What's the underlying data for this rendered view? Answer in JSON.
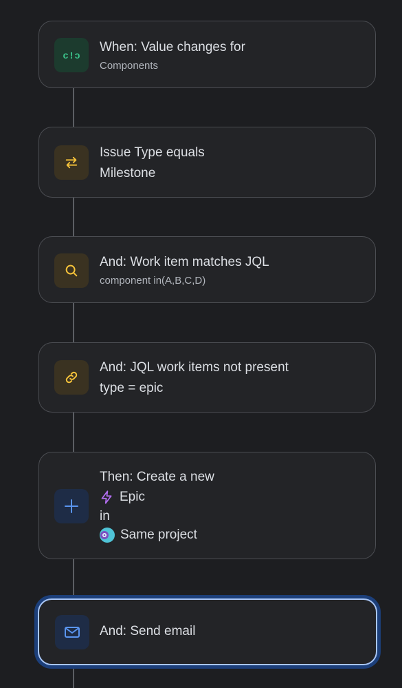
{
  "rule": {
    "trigger": {
      "title": "When: Value changes for",
      "subtitle": "Components",
      "icon": "trigger-icon",
      "tile_color": "#1c3b2e",
      "icon_color": "#3cc48c"
    },
    "condition_issue_type": {
      "title": "Issue Type equals",
      "subtitle": "Milestone",
      "icon": "swap-arrows-icon",
      "tile_color": "#3a3221",
      "icon_color": "#f5c23a"
    },
    "condition_jql": {
      "title": "And: Work item matches JQL",
      "subtitle": "component in(A,B,C,D)",
      "icon": "search-icon",
      "tile_color": "#3a3221",
      "icon_color": "#f5c23a"
    },
    "condition_related": {
      "title": "And: JQL work items not present",
      "subtitle": "type = epic",
      "icon": "link-icon",
      "tile_color": "#3a3221",
      "icon_color": "#f5c23a"
    },
    "action_create": {
      "title": "Then: Create a new",
      "issue_type": "Epic",
      "in_label": "in",
      "project": "Same project",
      "icon": "plus-icon",
      "tile_color": "#1e2c46",
      "icon_color": "#5a95f0",
      "epic_icon_color": "#b26ef0"
    },
    "action_email": {
      "title": "And: Send email",
      "icon": "mail-icon",
      "tile_color": "#1e2c46",
      "icon_color": "#5a95f0"
    }
  }
}
